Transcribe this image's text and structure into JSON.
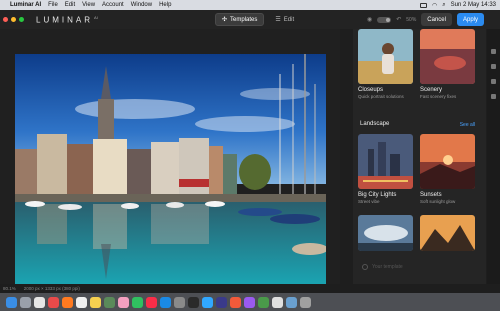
{
  "menubar": {
    "app_name": "Luminar AI",
    "items": [
      "File",
      "Edit",
      "View",
      "Account",
      "Window",
      "Help"
    ],
    "clock": "Sun 2 May  14:33"
  },
  "toolbar": {
    "logo": "LUMINAR",
    "logo_sup": "AI",
    "tabs": [
      {
        "label": "Templates",
        "icon": "templates-icon"
      },
      {
        "label": "Edit",
        "icon": "edit-icon"
      }
    ],
    "zoom_label": "50%",
    "cancel_label": "Cancel",
    "apply_label": "Apply"
  },
  "panel": {
    "cards_top": [
      {
        "title": "Closeups",
        "subtitle": "Quick portrait solutions"
      },
      {
        "title": "Scenery",
        "subtitle": "Fast scenery fixes"
      }
    ],
    "section_title": "Landscape",
    "see_all_label": "See all",
    "cards_landscape": [
      {
        "title": "Big City Lights",
        "subtitle": "Street vibe"
      },
      {
        "title": "Sunsets",
        "subtitle": "Soft sunlight glow"
      }
    ],
    "your_template_label": "Your template"
  },
  "status": {
    "zoom": "80.1%",
    "dimensions": "2000 px × 1333 px (380 ppi)"
  },
  "colors": {
    "accent": "#2b8bf0",
    "background": "#1e1e1e",
    "panel": "#252525"
  }
}
